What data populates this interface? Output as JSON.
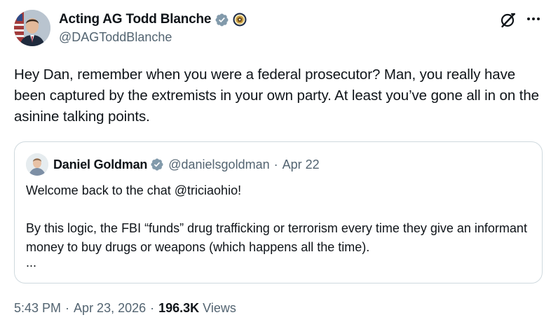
{
  "author": {
    "display_name": "Acting AG Todd Blanche",
    "handle": "@DAGToddBlanche"
  },
  "tweet": {
    "text": "Hey Dan, remember when you were a federal prosecutor? Man, you really have been captured by the extremists in your own party. At least you’ve gone all in on the asinine talking points."
  },
  "quoted_tweet": {
    "display_name": "Daniel Goldman",
    "handle": "@danielsgoldman",
    "separator": "·",
    "date": "Apr 22",
    "line1": "Welcome back to the chat @triciaohio!",
    "line2": "By this logic, the FBI “funds” drug trafficking or terrorism every time they give an informant money to buy drugs or weapons (which happens all the time).",
    "ellipsis": "..."
  },
  "meta": {
    "time": "5:43 PM",
    "sep1": "·",
    "date": "Apr 23, 2026",
    "sep2": "·",
    "views_count": "196.3K",
    "views_label": "Views"
  },
  "icons": {
    "verified": "verified-badge-icon",
    "seal": "doj-seal-icon",
    "grok": "grok-icon",
    "more": "more-options-icon"
  },
  "colors": {
    "text_primary": "#0f1419",
    "text_secondary": "#536471",
    "verified_blue": "#1d9bf0",
    "verified_gray": "#829aab",
    "border": "#cfd9de"
  }
}
